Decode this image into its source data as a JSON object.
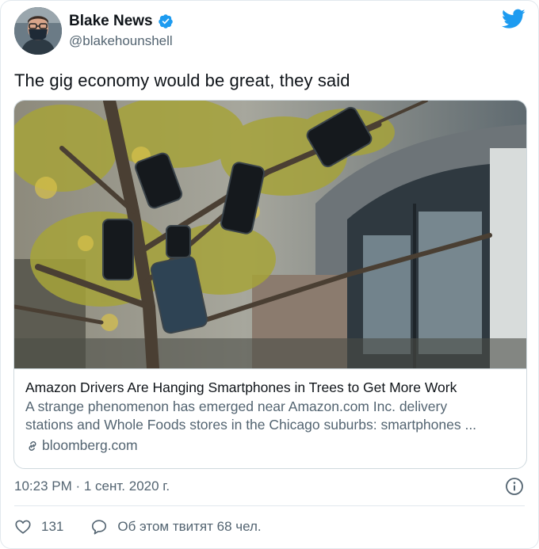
{
  "author": {
    "display_name": "Blake News",
    "handle": "@blakehounshell",
    "verified": true,
    "avatar_icon": "person-with-mask-avatar"
  },
  "tweet": {
    "text": "The gig economy would be great, they said"
  },
  "card": {
    "image_icon": "smartphones-hanging-in-tree-photo",
    "title": "Amazon Drivers Are Hanging Smartphones in Trees to Get More Work",
    "description_line1": "A strange phenomenon has emerged near Amazon.com Inc. delivery",
    "description_line2": "stations and Whole Foods stores in the Chicago suburbs: smartphones ...",
    "domain": "bloomberg.com"
  },
  "meta": {
    "timestamp": "10:23 PM · 1 сент. 2020 г."
  },
  "actions": {
    "likes": "131",
    "retweet_text": "Об этом твитят 68 чел."
  },
  "colors": {
    "twitter_blue": "#1d9bf0",
    "secondary_text": "#536471",
    "border": "#cfd9de"
  }
}
